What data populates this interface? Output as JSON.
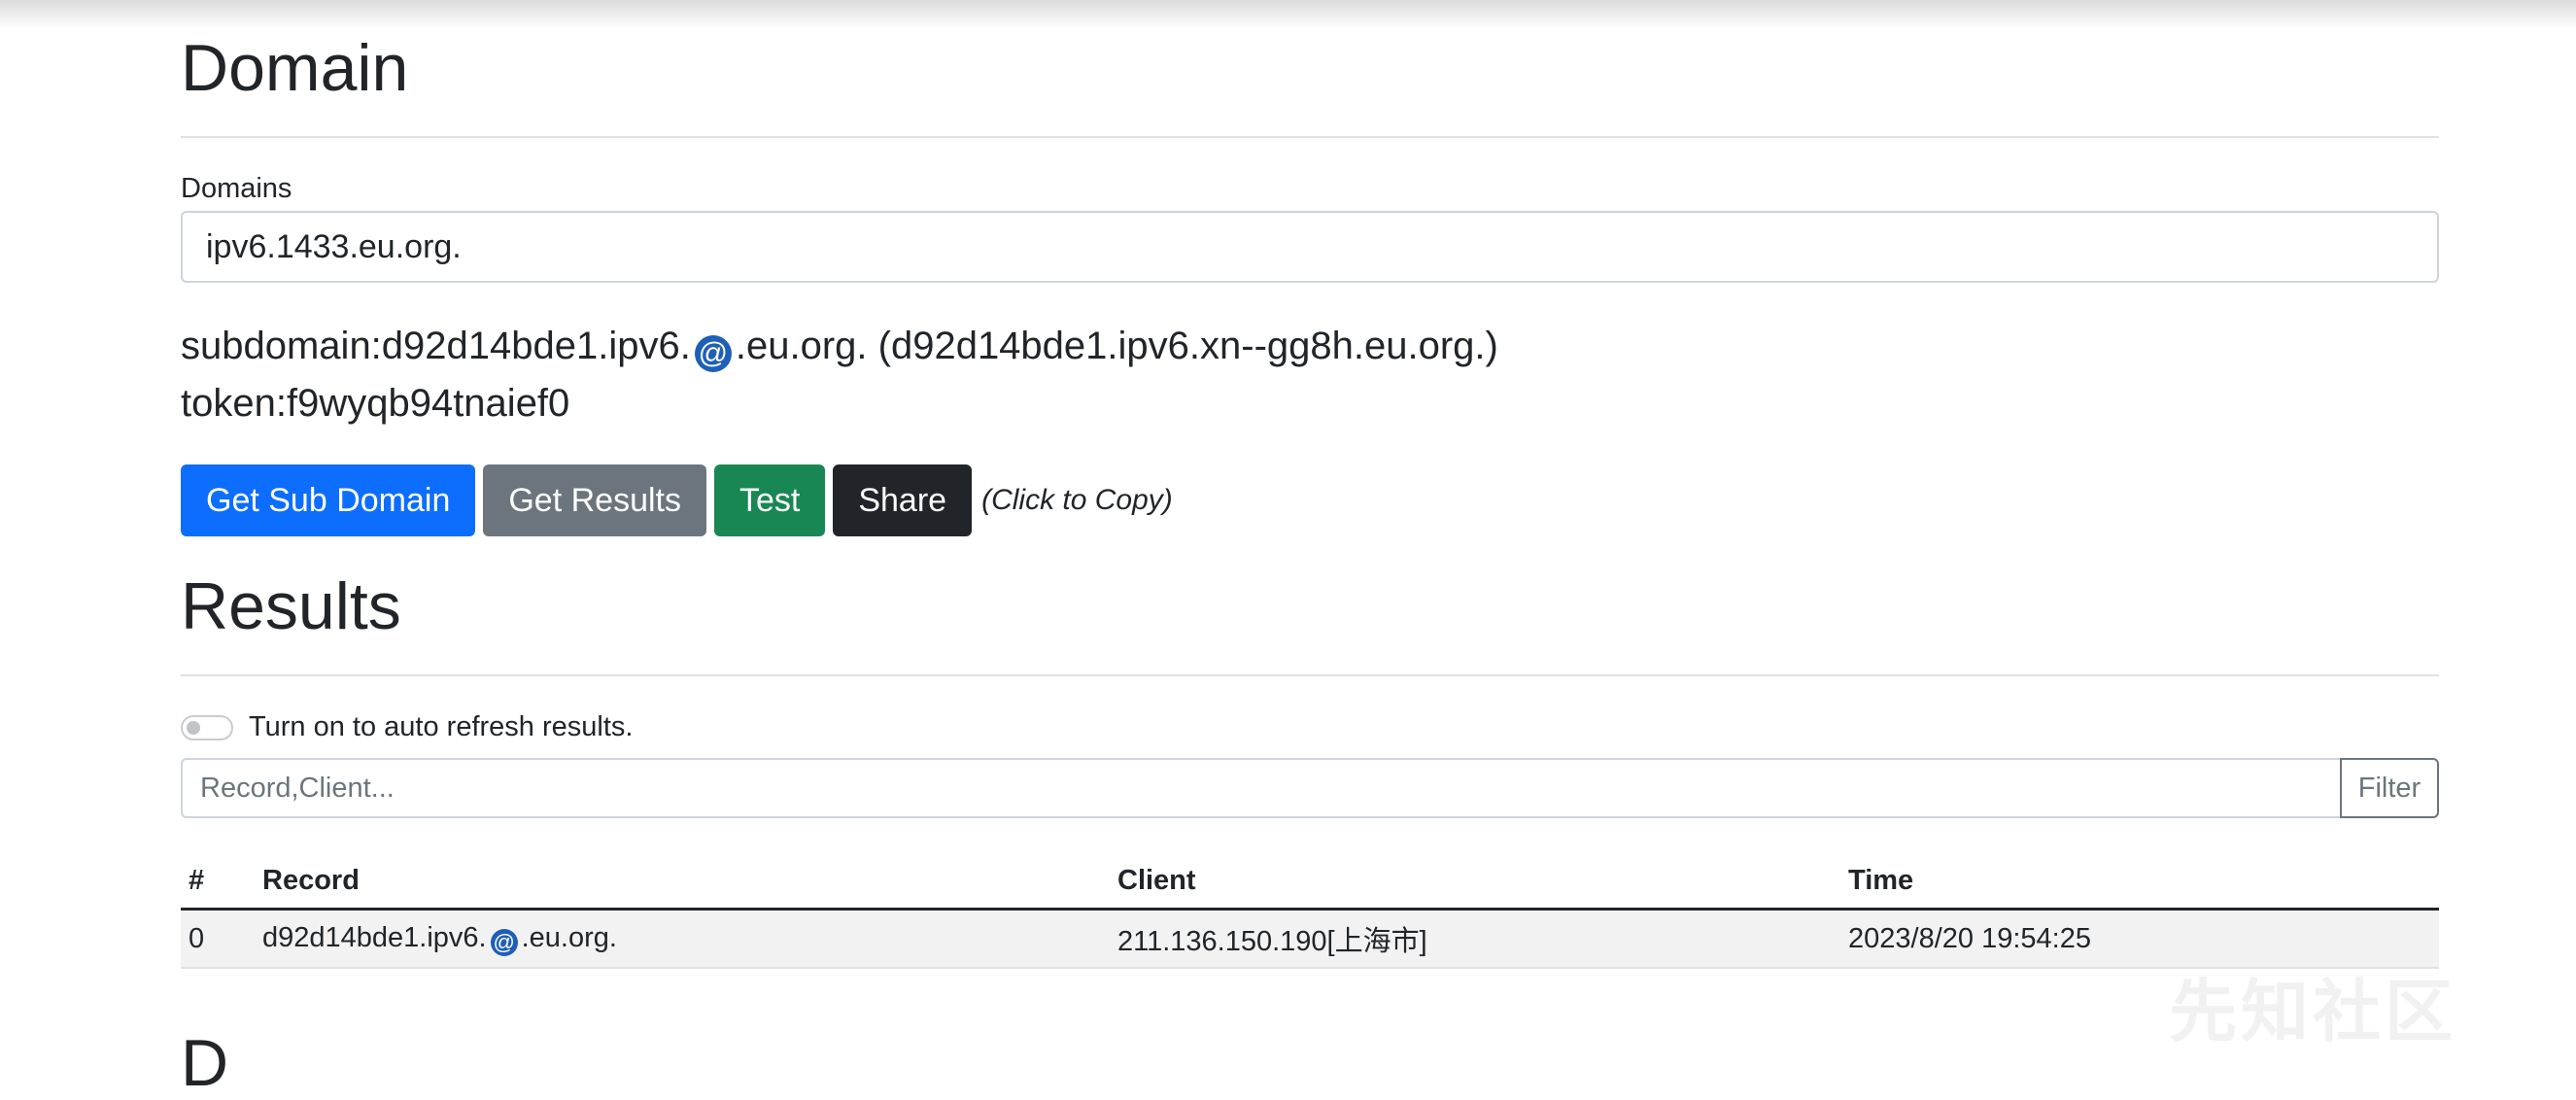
{
  "domain_section": {
    "title": "Domain",
    "domains_label": "Domains",
    "domains_value": "ipv6.1433.eu.org.",
    "subdomain_prefix": "subdomain:d92d14bde1.ipv6.",
    "subdomain_suffix": ".eu.org. (d92d14bde1.ipv6.xn--gg8h.eu.org.)",
    "token": "token:f9wyqb94tnaief0",
    "emoji_glyph": "🌀"
  },
  "buttons": {
    "get_sub_domain": "Get Sub Domain",
    "get_results": "Get Results",
    "test": "Test",
    "share": "Share",
    "copy_note": "(Click to Copy)"
  },
  "results_section": {
    "title": "Results",
    "auto_refresh_label": "Turn on to auto refresh results.",
    "auto_refresh_on": false,
    "filter_placeholder": "Record,Client...",
    "filter_button": "Filter",
    "table": {
      "headers": [
        "#",
        "Record",
        "Client",
        "Time"
      ],
      "rows": [
        {
          "index": "0",
          "record_prefix": "d92d14bde1.ipv6.",
          "record_suffix": ".eu.org.",
          "client": "211.136.150.190[上海市]",
          "time": "2023/8/20 19:54:25"
        }
      ]
    }
  },
  "next_section_partial": "D",
  "watermark": "先知社区",
  "colors": {
    "primary": "#0d6efd",
    "secondary": "#6c757d",
    "success": "#198754",
    "dark": "#212529"
  }
}
